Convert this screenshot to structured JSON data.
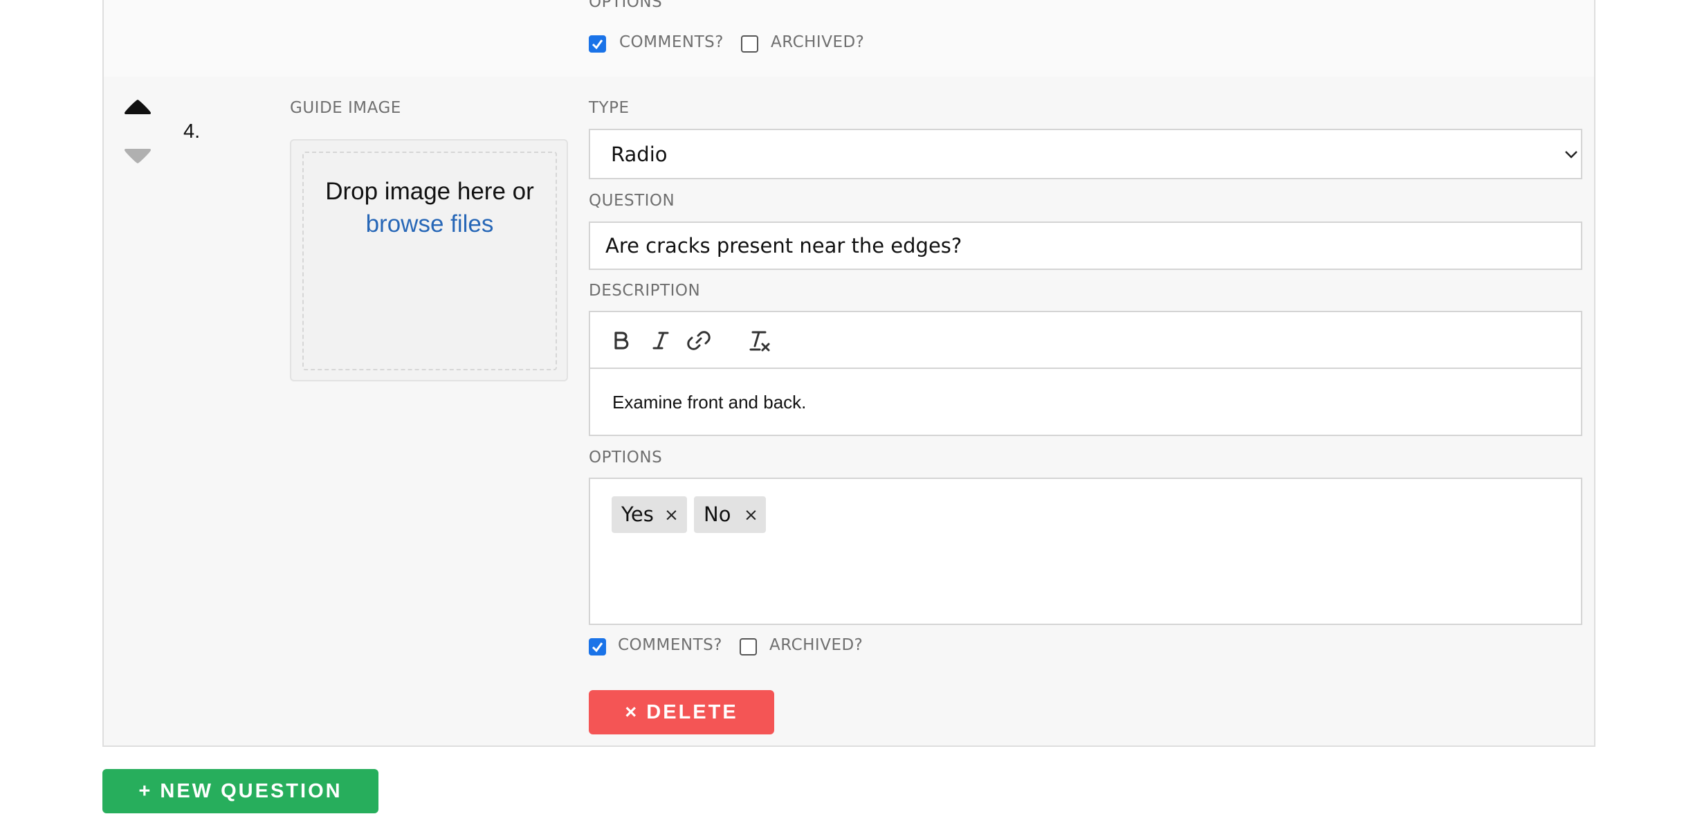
{
  "previous_question": {
    "options_label": "OPTIONS",
    "comments_label": "COMMENTS?",
    "comments_checked": true,
    "archived_label": "ARCHIVED?",
    "archived_checked": false
  },
  "question": {
    "number": "4.",
    "move_up_icon": "triangle-up-icon",
    "move_down_icon": "triangle-down-icon",
    "guide_image": {
      "label": "GUIDE IMAGE",
      "drop_text": "Drop image here or",
      "browse_text": "browse files"
    },
    "type": {
      "label": "TYPE",
      "value": "Radio"
    },
    "question": {
      "label": "QUESTION",
      "value": "Are cracks present near the edges?"
    },
    "description": {
      "label": "DESCRIPTION",
      "toolbar": [
        "bold-icon",
        "italic-icon",
        "link-icon",
        "clear-format-icon"
      ],
      "value": "Examine front and back."
    },
    "options": {
      "label": "OPTIONS",
      "tags": [
        "Yes",
        "No"
      ],
      "remove_glyph": "×"
    },
    "comments_label": "COMMENTS?",
    "comments_checked": true,
    "archived_label": "ARCHIVED?",
    "archived_checked": false,
    "delete_label": "× DELETE"
  },
  "new_question_label": "+ NEW QUESTION",
  "colors": {
    "delete": "#f45555",
    "new_question": "#27ae5c",
    "checkbox": "#1a73e8",
    "link": "#2767b7"
  }
}
